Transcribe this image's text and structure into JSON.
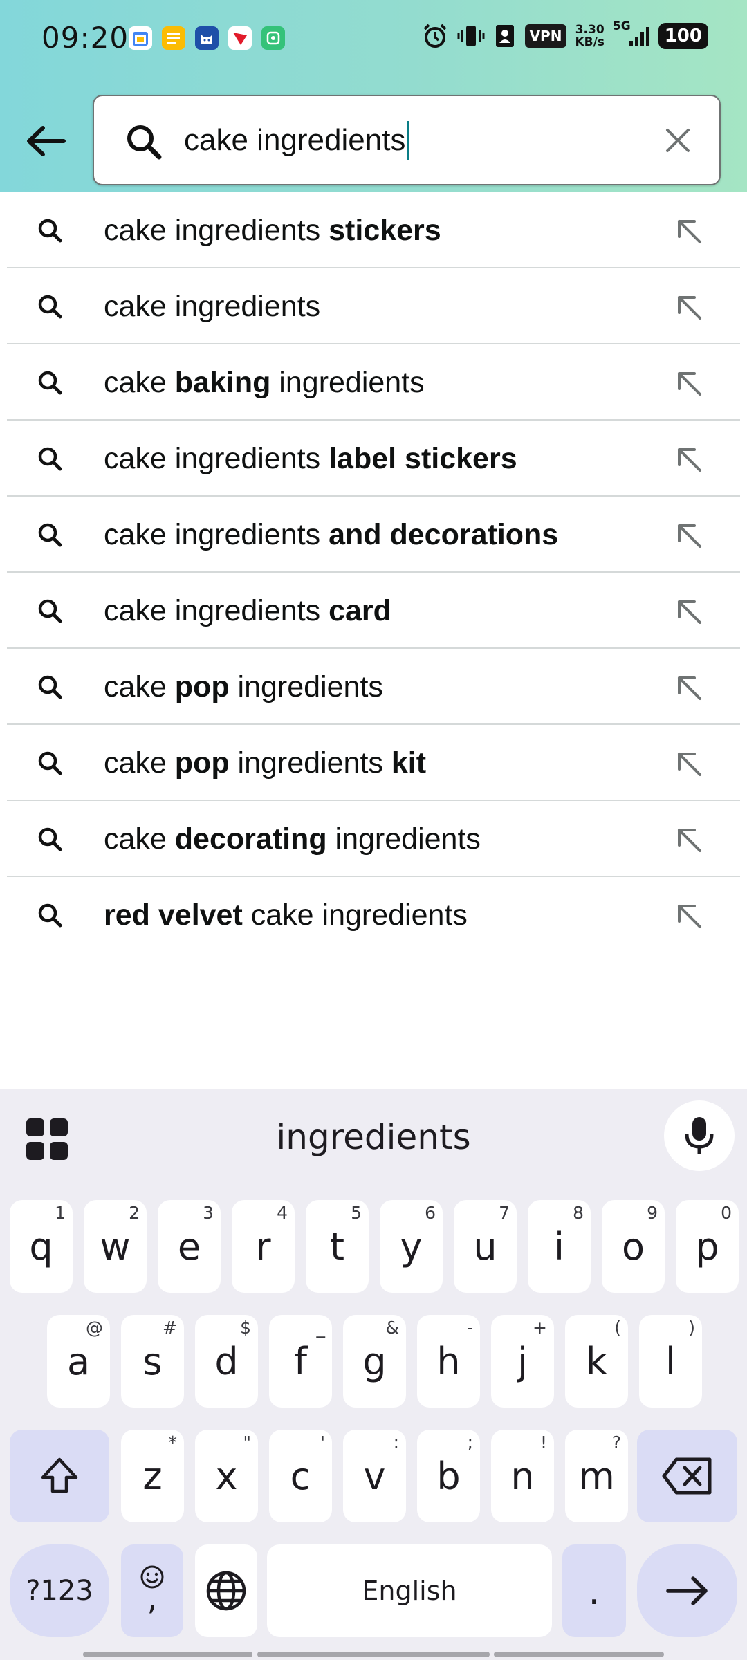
{
  "status_bar": {
    "time": "09:20",
    "vpn": "VPN",
    "speed_value": "3.30",
    "speed_unit": "KB/s",
    "network": "5G",
    "battery": "100"
  },
  "search": {
    "query": "cake ingredients"
  },
  "suggestions": [
    {
      "parts": [
        {
          "t": "cake ingredients ",
          "b": false
        },
        {
          "t": "stickers",
          "b": true
        }
      ]
    },
    {
      "parts": [
        {
          "t": "cake ingredients",
          "b": false
        }
      ]
    },
    {
      "parts": [
        {
          "t": "cake ",
          "b": false
        },
        {
          "t": "baking",
          "b": true
        },
        {
          "t": " ingredients",
          "b": false
        }
      ]
    },
    {
      "parts": [
        {
          "t": "cake ingredients ",
          "b": false
        },
        {
          "t": "label stickers",
          "b": true
        }
      ]
    },
    {
      "parts": [
        {
          "t": "cake ingredients ",
          "b": false
        },
        {
          "t": "and decorations",
          "b": true
        }
      ]
    },
    {
      "parts": [
        {
          "t": "cake ingredients ",
          "b": false
        },
        {
          "t": "card",
          "b": true
        }
      ]
    },
    {
      "parts": [
        {
          "t": "cake ",
          "b": false
        },
        {
          "t": "pop",
          "b": true
        },
        {
          "t": " ingredients",
          "b": false
        }
      ]
    },
    {
      "parts": [
        {
          "t": "cake ",
          "b": false
        },
        {
          "t": "pop",
          "b": true
        },
        {
          "t": " ingredients ",
          "b": false
        },
        {
          "t": "kit",
          "b": true
        }
      ]
    },
    {
      "parts": [
        {
          "t": "cake ",
          "b": false
        },
        {
          "t": "decorating",
          "b": true
        },
        {
          "t": " ingredients",
          "b": false
        }
      ]
    },
    {
      "parts": [
        {
          "t": "red velvet",
          "b": true
        },
        {
          "t": " cake ingredients",
          "b": false
        }
      ]
    }
  ],
  "keyboard": {
    "suggestion": "ingredients",
    "row1": [
      {
        "k": "q",
        "h": "1"
      },
      {
        "k": "w",
        "h": "2"
      },
      {
        "k": "e",
        "h": "3"
      },
      {
        "k": "r",
        "h": "4"
      },
      {
        "k": "t",
        "h": "5"
      },
      {
        "k": "y",
        "h": "6"
      },
      {
        "k": "u",
        "h": "7"
      },
      {
        "k": "i",
        "h": "8"
      },
      {
        "k": "o",
        "h": "9"
      },
      {
        "k": "p",
        "h": "0"
      }
    ],
    "row2": [
      {
        "k": "a",
        "h": "@"
      },
      {
        "k": "s",
        "h": "#"
      },
      {
        "k": "d",
        "h": "$"
      },
      {
        "k": "f",
        "h": "_"
      },
      {
        "k": "g",
        "h": "&"
      },
      {
        "k": "h",
        "h": "-"
      },
      {
        "k": "j",
        "h": "+"
      },
      {
        "k": "k",
        "h": "("
      },
      {
        "k": "l",
        "h": ")"
      }
    ],
    "row3": [
      {
        "k": "z",
        "h": "*"
      },
      {
        "k": "x",
        "h": "\""
      },
      {
        "k": "c",
        "h": "'"
      },
      {
        "k": "v",
        "h": ":"
      },
      {
        "k": "b",
        "h": ";"
      },
      {
        "k": "n",
        "h": "!"
      },
      {
        "k": "m",
        "h": "?"
      }
    ],
    "symbols_label": "?123",
    "comma": ",",
    "space_label": "English",
    "period": "."
  },
  "icons": {
    "back": "arrow-left-icon",
    "search": "search-icon",
    "clear": "close-icon",
    "fill_query": "arrow-up-left-icon",
    "apps": "grid-icon",
    "mic": "microphone-icon",
    "shift": "shift-icon",
    "backspace": "backspace-icon",
    "emoji": "emoji-icon",
    "language": "globe-icon",
    "enter": "arrow-right-icon"
  },
  "colors": {
    "header_gradient_start": "#83d7da",
    "header_gradient_end": "#a5e5c4",
    "caret": "#0a7d86",
    "keyboard_bg": "#eeedf3",
    "special_key": "#dadcf5"
  }
}
